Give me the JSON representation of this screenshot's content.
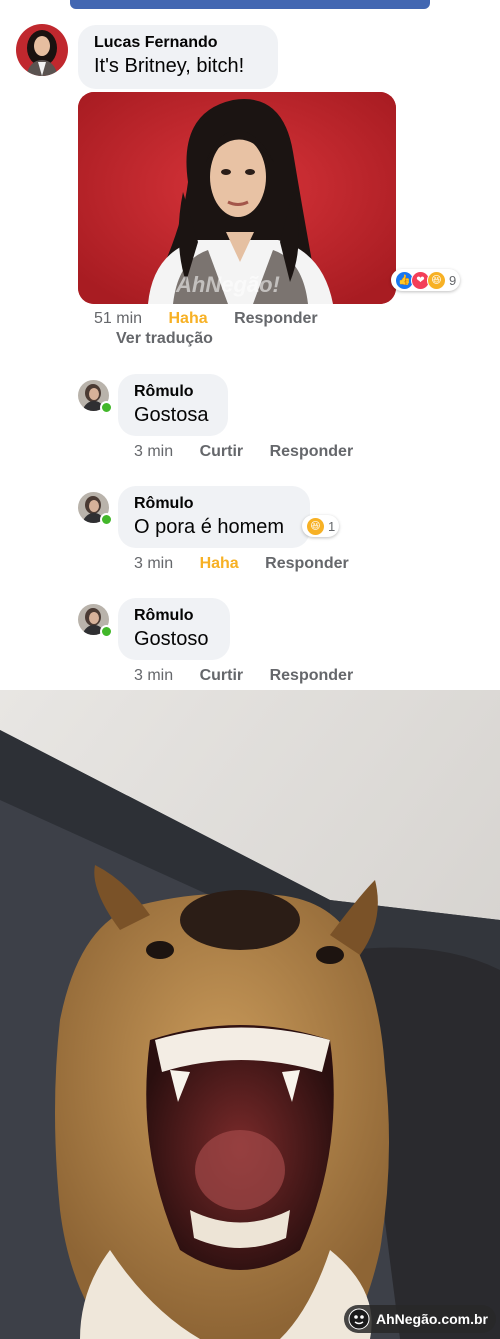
{
  "comments": [
    {
      "author": "Lucas Fernando",
      "text": "It's Britney, bitch!",
      "time": "51 min",
      "reaction_action": "Haha",
      "reply": "Responder",
      "reactions_count": "9",
      "reaction_icons": [
        "like-icon",
        "love-icon",
        "haha-icon"
      ],
      "translate": "Ver tradução",
      "attachment_watermark": "AhNegão!"
    },
    {
      "author": "Rômulo",
      "text": "Gostosa",
      "time": "3 min",
      "reaction_action": "Curtir",
      "reply": "Responder"
    },
    {
      "author": "Rômulo",
      "text": "O pora é homem",
      "time": "3 min",
      "reaction_action": "Haha",
      "reply": "Responder",
      "reactions_count": "1"
    },
    {
      "author": "Rômulo",
      "text": "Gostoso",
      "time": "3 min",
      "reaction_action": "Curtir",
      "reply": "Responder"
    }
  ],
  "watermark": {
    "text": "AhNegão.com.br"
  },
  "colors": {
    "haha": "#f7b125",
    "like": "#1877f2",
    "love": "#f33e58",
    "online": "#42b72a",
    "facebook_blue": "#4267b2"
  }
}
